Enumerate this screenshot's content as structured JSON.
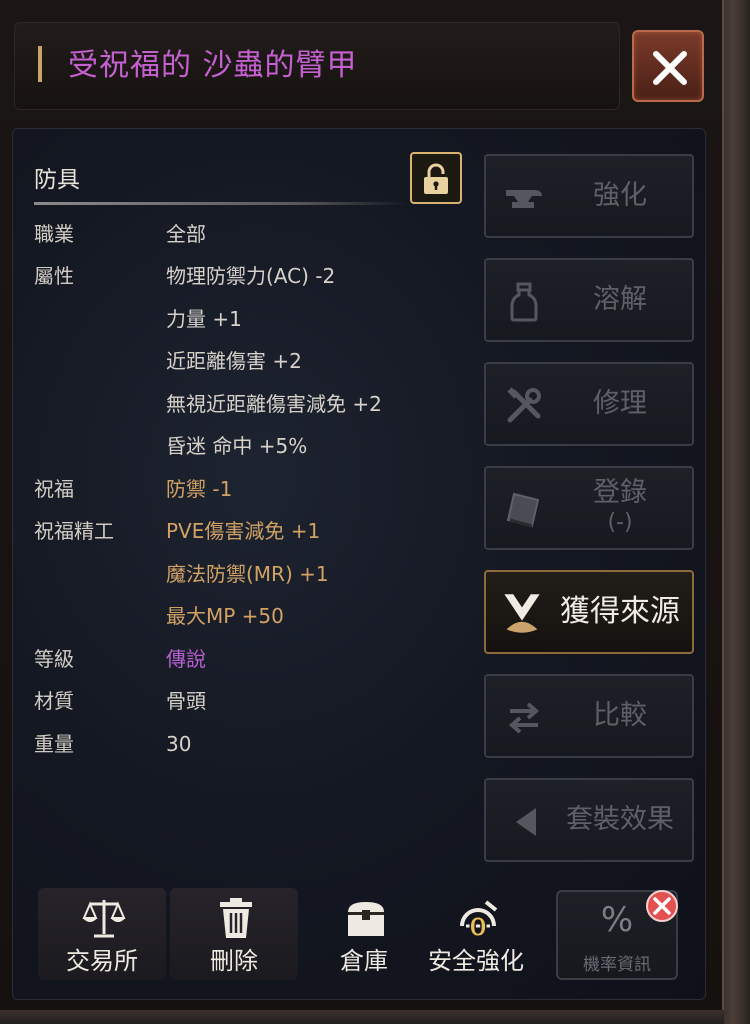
{
  "header": {
    "title": "受祝福的 沙蟲的臂甲",
    "close_icon": "close-icon"
  },
  "item": {
    "category": "防具",
    "lock_icon": "unlock-icon",
    "rows": {
      "class_label": "職業",
      "class_value": "全部",
      "attr_label": "屬性",
      "attr_values": [
        "物理防禦力(AC) -2",
        "力量 +1",
        "近距離傷害 +2",
        "無視近距離傷害減免 +2",
        "昏迷 命中 +5%"
      ],
      "bless_label": "祝福",
      "bless_value": "防禦 -1",
      "bless_craft_label": "祝福精工",
      "bless_craft_values": [
        "PVE傷害減免 +1",
        "魔法防禦(MR) +1",
        "最大MP +50"
      ],
      "grade_label": "等級",
      "grade_value": "傳說",
      "material_label": "材質",
      "material_value": "骨頭",
      "weight_label": "重量",
      "weight_value": "30"
    }
  },
  "side_buttons": [
    {
      "label": "強化",
      "icon": "anvil-icon",
      "enabled": false
    },
    {
      "label": "溶解",
      "icon": "bottle-icon",
      "enabled": false
    },
    {
      "label": "修理",
      "icon": "tools-icon",
      "enabled": false
    },
    {
      "label": "登錄",
      "sub": "(-)",
      "icon": "book-icon",
      "enabled": false
    },
    {
      "label": "獲得來源",
      "icon": "source-icon",
      "enabled": true
    },
    {
      "label": "比較",
      "icon": "swap-arrows-icon",
      "enabled": false
    },
    {
      "label": "套裝效果",
      "icon": "triangle-left-icon",
      "enabled": false
    }
  ],
  "bottom_buttons": [
    {
      "label": "交易所",
      "icon": "scales-icon"
    },
    {
      "label": "刪除",
      "icon": "trash-icon"
    },
    {
      "label": "倉庫",
      "icon": "chest-icon"
    },
    {
      "label": "安全強化",
      "icon": "safe-enhance-icon",
      "badge": "0"
    },
    {
      "label": "機率資訊",
      "icon": "percent-icon"
    }
  ],
  "colors": {
    "title": "#c560d0",
    "gold_text": "#d2a265",
    "legendary": "#b95fd0",
    "disabled_text": "#5e6068"
  }
}
